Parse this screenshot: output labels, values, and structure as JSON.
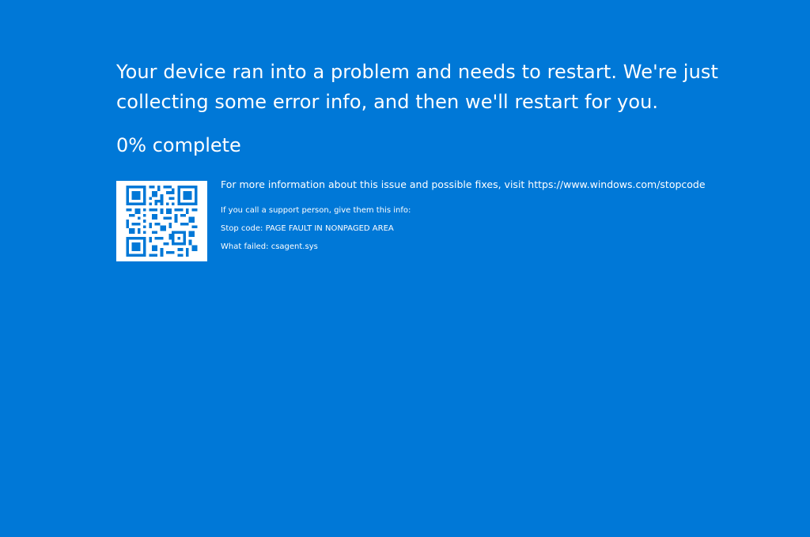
{
  "colors": {
    "background": "#0078d7",
    "text": "#ffffff"
  },
  "message": {
    "line1": "Your device ran into a problem and needs to restart. We're just",
    "line2": "collecting some error info, and then we'll restart for you."
  },
  "progress": {
    "percent": 0,
    "text": "0% complete"
  },
  "info": {
    "more_info": "For more information about this issue and possible fixes, visit https://www.windows.com/stopcode",
    "support": "If you call a support person, give them this info:",
    "stop_code": "Stop code: PAGE FAULT IN NONPAGED AREA",
    "what_failed": "What failed: csagent.sys"
  },
  "icons": {
    "qr": "qr-code-icon"
  }
}
